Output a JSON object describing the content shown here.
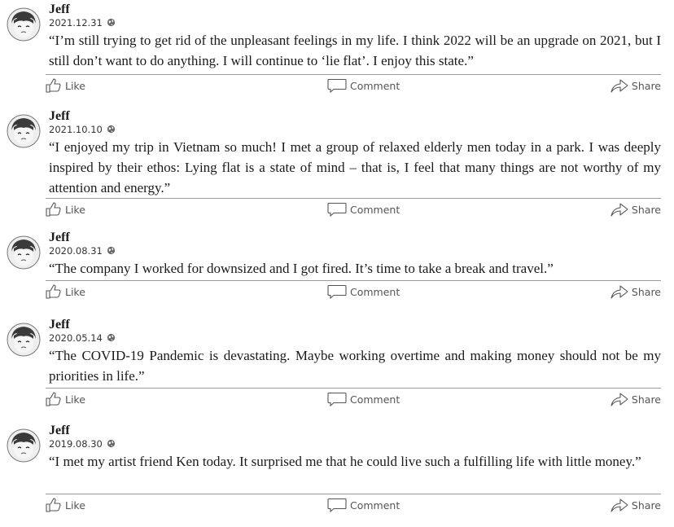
{
  "actions": {
    "like": "Like",
    "comment": "Comment",
    "share": "Share"
  },
  "posts": [
    {
      "author": "Jeff",
      "date": "2021.12.31",
      "text": "“I’m still trying  to get rid of the unpleasant feelings in my life. I think 2022 will be an upgrade on 2021, but I still don’t want to do anything. I will continue to ‘lie flat’. I enjoy this state.”"
    },
    {
      "author": "Jeff",
      "date": "2021.10.10",
      "text": "“I enjoyed my trip in Vietnam so much! I met a group of relaxed elderly men today in a park. I was deeply inspired by their ethos: Lying flat is a state of mind – that is, I feel that many things are not worthy of my attention and energy.”"
    },
    {
      "author": "Jeff",
      "date": "2020.08.31",
      "text": "“The company I worked for downsized and I got fired. It’s time to take a break and travel.”"
    },
    {
      "author": "Jeff",
      "date": "2020.05.14",
      "text": "“The COVID-19 Pandemic is devastating. Maybe working overtime and making money should not be my priorities in life.”"
    },
    {
      "author": "Jeff",
      "date": "2019.08.30",
      "text": "“I met my artist friend Ken today. It surprised me that he could live such a fulfilling life with little money.”"
    }
  ]
}
